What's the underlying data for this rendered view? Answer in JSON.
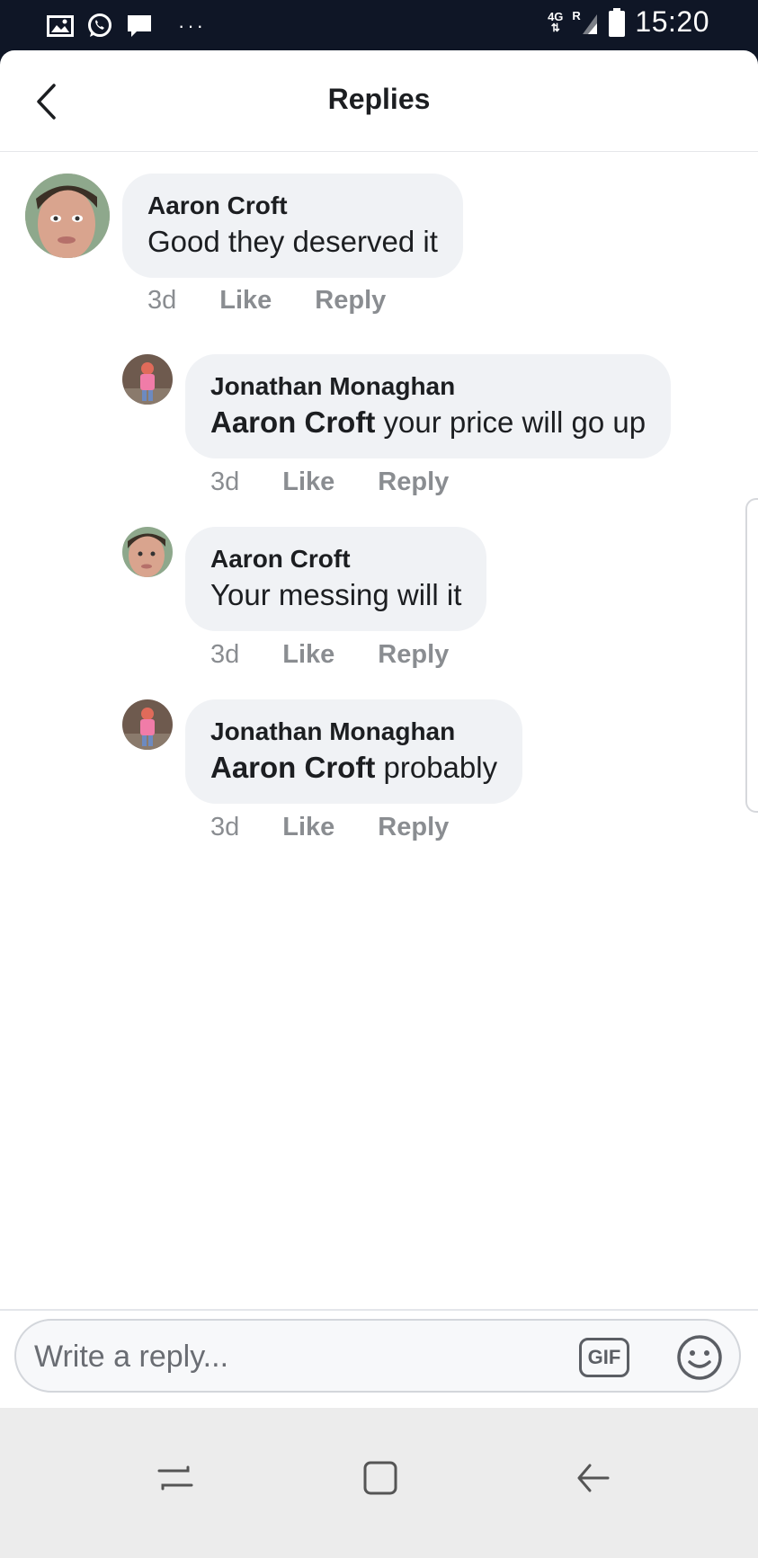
{
  "status_bar": {
    "time": "15:20",
    "network_top": "4G",
    "network_roaming": "R",
    "more_dots": "···"
  },
  "header": {
    "title": "Replies"
  },
  "comments": [
    {
      "author": "Aaron Croft",
      "mention": "",
      "text": "Good they deserved it",
      "time": "3d",
      "like": "Like",
      "reply": "Reply"
    },
    {
      "author": "Jonathan Monaghan",
      "mention": "Aaron Croft",
      "text": " your price will go up",
      "time": "3d",
      "like": "Like",
      "reply": "Reply"
    },
    {
      "author": "Aaron Croft",
      "mention": "",
      "text": "Your messing will it",
      "time": "3d",
      "like": "Like",
      "reply": "Reply"
    },
    {
      "author": "Jonathan Monaghan",
      "mention": "Aaron Croft",
      "text": " probably",
      "time": "3d",
      "like": "Like",
      "reply": "Reply"
    }
  ],
  "composer": {
    "placeholder": "Write a reply...",
    "gif_label": "GIF"
  },
  "colors": {
    "status_bar_bg": "#0f1626",
    "bubble_bg": "#f0f2f5",
    "text_primary": "#1c1e21",
    "text_secondary": "#8a8d91",
    "nav_bar_bg": "#ececec"
  }
}
